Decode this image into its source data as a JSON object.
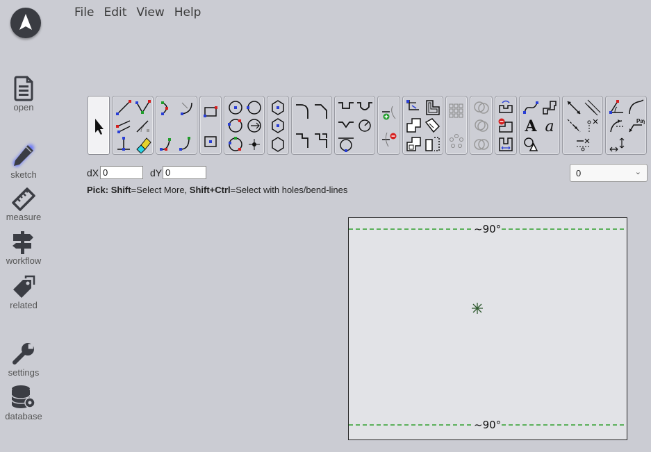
{
  "menu": {
    "file": "File",
    "edit": "Edit",
    "view": "View",
    "help": "Help"
  },
  "sidebar": {
    "items": [
      {
        "label": "open",
        "icon": "document-icon"
      },
      {
        "label": "sketch",
        "icon": "pencil-icon",
        "active": true
      },
      {
        "label": "measure",
        "icon": "ruler-icon"
      },
      {
        "label": "workflow",
        "icon": "signpost-icon"
      },
      {
        "label": "related",
        "icon": "tags-icon"
      },
      {
        "label": "settings",
        "icon": "wrench-icon"
      },
      {
        "label": "database",
        "icon": "database-gear-icon"
      }
    ]
  },
  "coords": {
    "dx_label": "dX",
    "dx_value": "0",
    "dy_label": "dY",
    "dy_value": "0"
  },
  "layer_select": {
    "value": "0"
  },
  "hint": {
    "pick": "Pick",
    "sep1": ": ",
    "shift": "Shift",
    "text1": "=Select More, ",
    "shift_ctrl": "Shift+Ctrl",
    "text2": "=Select with holes/bend-lines"
  },
  "canvas": {
    "bend_top": "~90°",
    "bend_bottom": "~90°"
  },
  "colors": {
    "accent_blue": "#2a3fd6",
    "accent_red": "#d61f1f",
    "accent_green": "#1f9d2a",
    "bend_line": "#2ca02c"
  }
}
